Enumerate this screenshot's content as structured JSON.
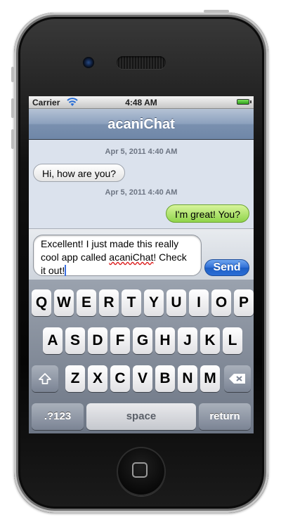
{
  "status_bar": {
    "carrier": "Carrier",
    "time": "4:48 AM"
  },
  "nav": {
    "title": "acaniChat"
  },
  "messages": [
    {
      "timestamp": "Apr 5, 2011 4:40 AM",
      "text": "Hi, how are you?",
      "direction": "incoming"
    },
    {
      "timestamp": "Apr 5, 2011 4:40 AM",
      "text": "I'm great! You?",
      "direction": "outgoing"
    }
  ],
  "composer": {
    "line1": "Excellent! I just made this really",
    "line2_pre": "cool app called ",
    "line2_word": "acaniChat",
    "line2_post": "! Check",
    "line3": "it out!",
    "send_label": "Send"
  },
  "keyboard": {
    "row1": [
      "Q",
      "W",
      "E",
      "R",
      "T",
      "Y",
      "U",
      "I",
      "O",
      "P"
    ],
    "row2": [
      "A",
      "S",
      "D",
      "F",
      "G",
      "H",
      "J",
      "K",
      "L"
    ],
    "row3": [
      "Z",
      "X",
      "C",
      "V",
      "B",
      "N",
      "M"
    ],
    "shift_icon": "shift-icon",
    "backspace_icon": "backspace-icon",
    "numbers_label": ".?123",
    "space_label": "space",
    "return_label": "return"
  },
  "colors": {
    "nav_bar": "#7a90af",
    "incoming_bubble": "#ffffff",
    "outgoing_bubble": "#8fd44b",
    "send_button": "#2f6fd6",
    "chat_background": "#dbe2ed"
  }
}
